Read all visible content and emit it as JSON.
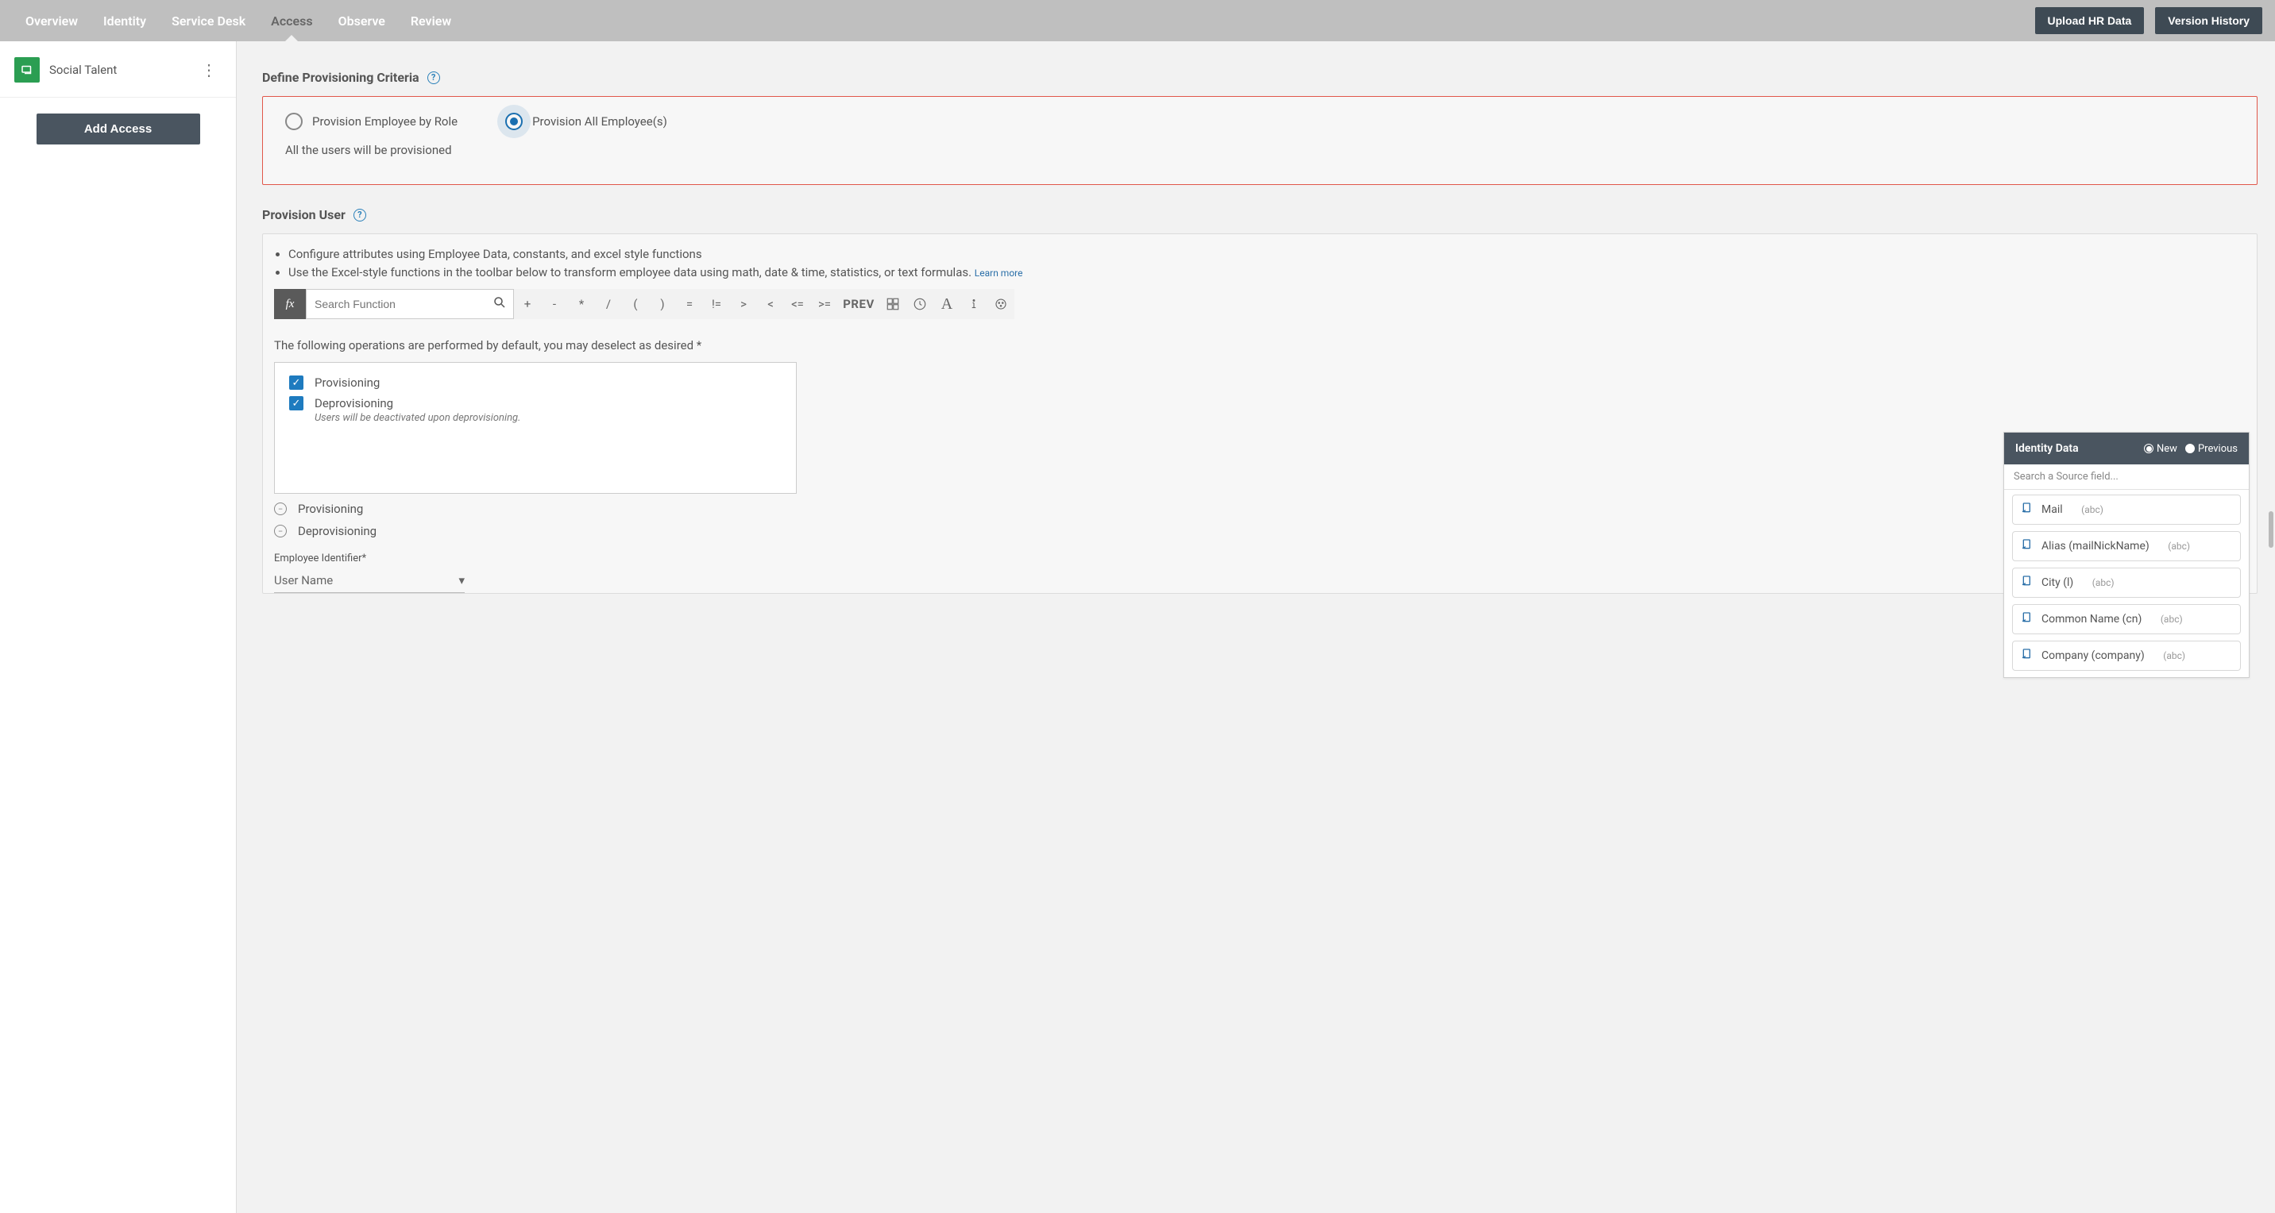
{
  "topbar": {
    "tabs": [
      "Overview",
      "Identity",
      "Service Desk",
      "Access",
      "Observe",
      "Review"
    ],
    "activeIndex": 3,
    "uploadBtn": "Upload HR Data",
    "versionBtn": "Version History"
  },
  "sidebar": {
    "appName": "Social Talent",
    "addBtn": "Add Access"
  },
  "criteria": {
    "title": "Define Provisioning Criteria",
    "byRole": "Provision Employee by Role",
    "allEmp": "Provision All Employee(s)",
    "note": "All the users will be provisioned"
  },
  "provUser": {
    "title": "Provision User",
    "tip1": "Configure attributes using Employee Data, constants, and excel style functions",
    "tip2": "Use the Excel-style functions in the toolbar below to transform employee data using math, date & time, statistics, or text formulas.",
    "learn": "Learn more",
    "searchPlaceholder": "Search Function",
    "ops": [
      "+",
      "-",
      "*",
      "/",
      "(",
      ")",
      "=",
      "!=",
      ">",
      "<",
      "<=",
      ">="
    ],
    "prev": "PREV",
    "subNote": "The following operations are performed by default, you may deselect as desired *",
    "chkProv": "Provisioning",
    "chkDeprov": "Deprovisioning",
    "deprovNote": "Users will be deactivated upon deprovisioning.",
    "collProv": "Provisioning",
    "collDeprov": "Deprovisioning",
    "empIdLabel": "Employee Identifier*",
    "empIdValue": "User Name"
  },
  "identity": {
    "title": "Identity Data",
    "newLabel": "New",
    "prevLabel": "Previous",
    "searchPlaceholder": "Search a Source field...",
    "items": [
      {
        "label": "Mail",
        "type": "(abc)"
      },
      {
        "label": "Alias (mailNickName)",
        "type": "(abc)"
      },
      {
        "label": "City (l)",
        "type": "(abc)"
      },
      {
        "label": "Common Name (cn)",
        "type": "(abc)"
      },
      {
        "label": "Company (company)",
        "type": "(abc)"
      }
    ]
  }
}
